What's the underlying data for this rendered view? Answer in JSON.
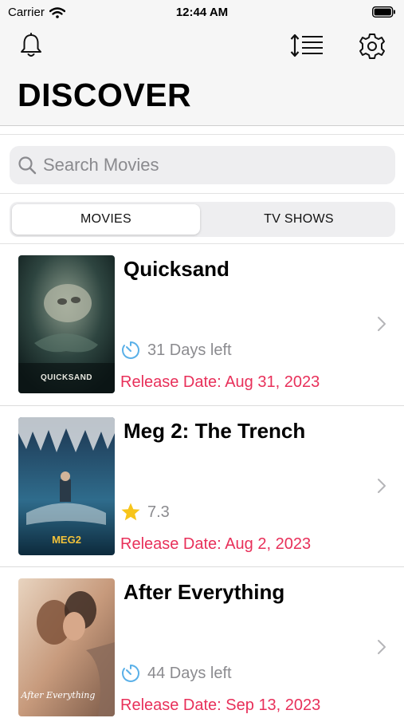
{
  "status_bar": {
    "carrier": "Carrier",
    "time": "12:44 AM"
  },
  "header": {
    "title": "DISCOVER",
    "icons": [
      "bell-icon",
      "sort-icon",
      "gear-icon"
    ]
  },
  "search": {
    "placeholder": "Search Movies",
    "value": ""
  },
  "segmented": {
    "tabs": [
      {
        "label": "MOVIES",
        "selected": true
      },
      {
        "label": "TV SHOWS",
        "selected": false
      }
    ]
  },
  "movies": [
    {
      "title": "Quicksand",
      "meta_icon": "timer-icon",
      "meta_text": "31 Days left",
      "release": "Release Date: Aug 31, 2023",
      "poster_caption": "QUICKSAND"
    },
    {
      "title": "Meg 2: The Trench",
      "meta_icon": "star-icon",
      "meta_text": "7.3",
      "release": "Release Date: Aug 2, 2023",
      "poster_caption": "MEG2"
    },
    {
      "title": "After Everything",
      "meta_icon": "timer-icon",
      "meta_text": "44 Days left",
      "release": "Release Date: Sep 13, 2023",
      "poster_caption": "After Everything"
    }
  ],
  "colors": {
    "accent_release": "#e8305a",
    "timer_blue": "#5ab0e8",
    "star_yellow": "#f7c51b",
    "header_bg": "#f6f6f6"
  }
}
